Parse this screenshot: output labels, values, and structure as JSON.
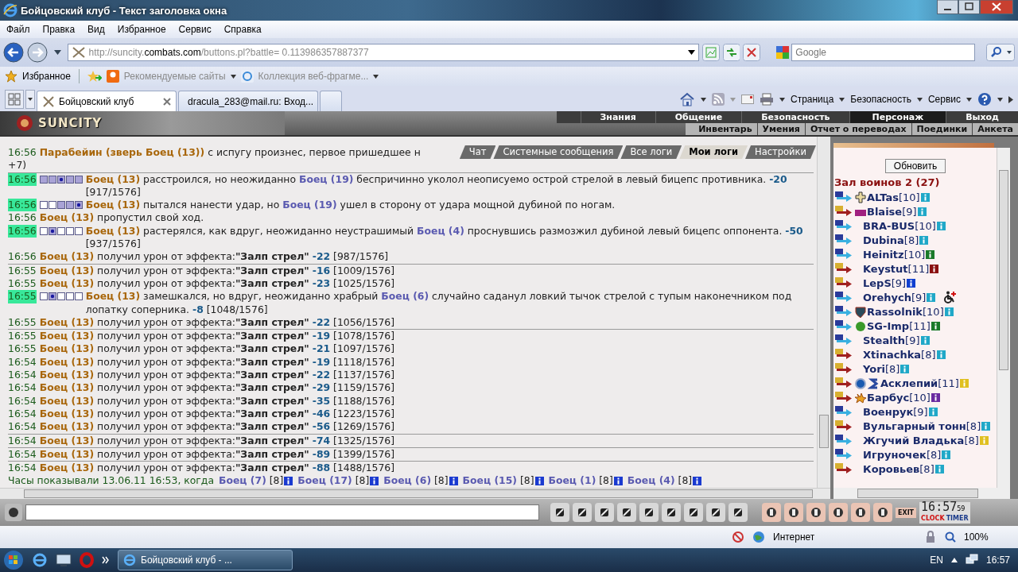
{
  "window": {
    "title": "Бойцовский клуб - Текст заголовка окна"
  },
  "menu": [
    "Файл",
    "Правка",
    "Вид",
    "Избранное",
    "Сервис",
    "Справка"
  ],
  "address": {
    "prefix": "http://suncity.",
    "domain": "combats.com",
    "path": "/buttons.pl?battle= 0.113986357887377"
  },
  "search": {
    "placeholder": "Google"
  },
  "favorites": {
    "label": "Избранное",
    "links": [
      "Рекомендуемые сайты",
      "Коллекция веб-фрагме..."
    ]
  },
  "tabs": [
    {
      "label": "Бойцовский клуб",
      "selected": true
    },
    {
      "label": "dracula_283@mail.ru: Вход...",
      "selected": false
    }
  ],
  "commands": [
    "Страница",
    "Безопасность",
    "Сервис"
  ],
  "game": {
    "logo": "SUNCITY",
    "nav": [
      {
        "label": "Знания",
        "selected": false
      },
      {
        "label": "Общение",
        "selected": false
      },
      {
        "label": "Безопасность",
        "selected": false
      },
      {
        "label": "Персонаж",
        "selected": true
      },
      {
        "label": "Выход",
        "selected": false
      }
    ],
    "subnav": [
      "Инвентарь",
      "Умения",
      "Отчет о переводах",
      "Поединки",
      "Анкета"
    ]
  },
  "log_tabs": [
    {
      "label": "Чат",
      "selected": false
    },
    {
      "label": "Системные сообщения",
      "selected": false
    },
    {
      "label": "Все логи",
      "selected": false
    },
    {
      "label": "Мои логи",
      "selected": true
    },
    {
      "label": "Настройки",
      "selected": false
    }
  ],
  "log": [
    {
      "kind": "action",
      "time": "16:56",
      "highlight": false,
      "divider": false,
      "parts": [
        {
          "kind": "actor",
          "text": "Парабейин (зверь Боец (13))"
        },
        {
          "kind": "text",
          "text": " с испугу произнес, первое пришедшее н"
        }
      ]
    },
    {
      "kind": "action",
      "divider": false,
      "parts": [
        {
          "kind": "text",
          "text": "+7)"
        }
      ]
    },
    {
      "kind": "action",
      "time": "16:56",
      "highlight": true,
      "divider": true,
      "zones": [
        {
          "kind": "filled"
        },
        {
          "kind": "filled"
        },
        {
          "kind": "dot"
        },
        {
          "kind": "filled"
        },
        {
          "kind": "filled"
        }
      ],
      "parts": [
        {
          "kind": "actor",
          "text": "Боец (13)"
        },
        {
          "kind": "text",
          "text": " расстроился, но неожиданно "
        },
        {
          "kind": "target",
          "text": "Боец (19)"
        },
        {
          "kind": "text",
          "text": " беспричинно уколол неописуемо острой стрелой в левый бицепс противника. "
        },
        {
          "kind": "damage",
          "text": "-20"
        },
        {
          "kind": "text",
          "text": " [917/1576]"
        }
      ]
    },
    {
      "kind": "action",
      "time": "16:56",
      "highlight": true,
      "divider": false,
      "zones": [
        {
          "kind": "empty"
        },
        {
          "kind": "empty"
        },
        {
          "kind": "filled"
        },
        {
          "kind": "filled"
        },
        {
          "kind": "dot"
        }
      ],
      "parts": [
        {
          "kind": "actor",
          "text": "Боец (13)"
        },
        {
          "kind": "text",
          "text": " пытался нанести удар, но "
        },
        {
          "kind": "target",
          "text": "Боец (19)"
        },
        {
          "kind": "text",
          "text": " ушел в сторону от удара мощной дубиной по ногам."
        }
      ]
    },
    {
      "kind": "action",
      "time": "16:56",
      "highlight": false,
      "divider": false,
      "parts": [
        {
          "kind": "actor",
          "text": "Боец (13)"
        },
        {
          "kind": "text",
          "text": " пропустил свой ход."
        }
      ]
    },
    {
      "kind": "action",
      "time": "16:56",
      "highlight": true,
      "divider": false,
      "zones": [
        {
          "kind": "empty"
        },
        {
          "kind": "dot"
        },
        {
          "kind": "empty"
        },
        {
          "kind": "empty"
        },
        {
          "kind": "empty"
        }
      ],
      "parts": [
        {
          "kind": "actor",
          "text": "Боец (13)"
        },
        {
          "kind": "text",
          "text": " растерялся, как вдруг, неожиданно неустрашимый "
        },
        {
          "kind": "target",
          "text": "Боец (4)"
        },
        {
          "kind": "text",
          "text": " проснувшись размозжил дубиной левый бицепс оппонента. "
        },
        {
          "kind": "damage",
          "text": "-50"
        },
        {
          "kind": "text",
          "text": " [937/1576]"
        }
      ]
    },
    {
      "kind": "effect",
      "time": "16:56",
      "highlight": false,
      "divider": false,
      "actor": "Боец (13)",
      "text": " получил урон от эффекта:",
      "effect": "\"Залп стрел\"",
      "damage": "-22",
      "hp": "[987/1576]"
    },
    {
      "kind": "effect",
      "time": "16:55",
      "highlight": false,
      "divider": true,
      "actor": "Боец (13)",
      "text": " получил урон от эффекта:",
      "effect": "\"Залп стрел\"",
      "damage": "-16",
      "hp": "[1009/1576]"
    },
    {
      "kind": "effect",
      "time": "16:55",
      "highlight": false,
      "divider": false,
      "actor": "Боец (13)",
      "text": " получил урон от эффекта:",
      "effect": "\"Залп стрел\"",
      "damage": "-23",
      "hp": "[1025/1576]"
    },
    {
      "kind": "action",
      "time": "16:55",
      "highlight": true,
      "divider": false,
      "zones": [
        {
          "kind": "empty"
        },
        {
          "kind": "dot"
        },
        {
          "kind": "empty"
        },
        {
          "kind": "empty"
        },
        {
          "kind": "empty"
        }
      ],
      "parts": [
        {
          "kind": "actor",
          "text": "Боец (13)"
        },
        {
          "kind": "text",
          "text": " замешкался, но вдруг, неожиданно храбрый "
        },
        {
          "kind": "target",
          "text": "Боец (6)"
        },
        {
          "kind": "text",
          "text": " случайно саданул ловкий тычок стрелой с тупым наконечником под лопатку соперника. "
        },
        {
          "kind": "damage",
          "text": "-8"
        },
        {
          "kind": "text",
          "text": " [1048/1576]"
        }
      ]
    },
    {
      "kind": "effect",
      "time": "16:55",
      "highlight": false,
      "divider": false,
      "actor": "Боец (13)",
      "text": " получил урон от эффекта:",
      "effect": "\"Залп стрел\"",
      "damage": "-22",
      "hp": "[1056/1576]"
    },
    {
      "kind": "effect",
      "time": "16:55",
      "highlight": false,
      "divider": true,
      "actor": "Боец (13)",
      "text": " получил урон от эффекта:",
      "effect": "\"Залп стрел\"",
      "damage": "-19",
      "hp": "[1078/1576]"
    },
    {
      "kind": "effect",
      "time": "16:55",
      "highlight": false,
      "divider": false,
      "actor": "Боец (13)",
      "text": " получил урон от эффекта:",
      "effect": "\"Залп стрел\"",
      "damage": "-21",
      "hp": "[1097/1576]"
    },
    {
      "kind": "effect",
      "time": "16:54",
      "highlight": false,
      "divider": false,
      "actor": "Боец (13)",
      "text": " получил урон от эффекта:",
      "effect": "\"Залп стрел\"",
      "damage": "-19",
      "hp": "[1118/1576]"
    },
    {
      "kind": "effect",
      "time": "16:54",
      "highlight": false,
      "divider": false,
      "actor": "Боец (13)",
      "text": " получил урон от эффекта:",
      "effect": "\"Залп стрел\"",
      "damage": "-22",
      "hp": "[1137/1576]"
    },
    {
      "kind": "effect",
      "time": "16:54",
      "highlight": false,
      "divider": false,
      "actor": "Боец (13)",
      "text": " получил урон от эффекта:",
      "effect": "\"Залп стрел\"",
      "damage": "-29",
      "hp": "[1159/1576]"
    },
    {
      "kind": "effect",
      "time": "16:54",
      "highlight": false,
      "divider": false,
      "actor": "Боец (13)",
      "text": " получил урон от эффекта:",
      "effect": "\"Залп стрел\"",
      "damage": "-35",
      "hp": "[1188/1576]"
    },
    {
      "kind": "effect",
      "time": "16:54",
      "highlight": false,
      "divider": false,
      "actor": "Боец (13)",
      "text": " получил урон от эффекта:",
      "effect": "\"Залп стрел\"",
      "damage": "-46",
      "hp": "[1223/1576]"
    },
    {
      "kind": "effect",
      "time": "16:54",
      "highlight": false,
      "divider": false,
      "actor": "Боец (13)",
      "text": " получил урон от эффекта:",
      "effect": "\"Залп стрел\"",
      "damage": "-56",
      "hp": "[1269/1576]"
    },
    {
      "kind": "effect",
      "time": "16:54",
      "highlight": false,
      "divider": true,
      "actor": "Боец (13)",
      "text": " получил урон от эффекта:",
      "effect": "\"Залп стрел\"",
      "damage": "-74",
      "hp": "[1325/1576]"
    },
    {
      "kind": "effect",
      "time": "16:54",
      "highlight": false,
      "divider": true,
      "actor": "Боец (13)",
      "text": " получил урон от эффекта:",
      "effect": "\"Залп стрел\"",
      "damage": "-89",
      "hp": "[1399/1576]"
    },
    {
      "kind": "effect",
      "time": "16:54",
      "highlight": false,
      "divider": true,
      "actor": "Боец (13)",
      "text": " получил урон от эффекта:",
      "effect": "\"Залп стрел\"",
      "damage": "-88",
      "hp": "[1488/1576]"
    },
    {
      "kind": "summary",
      "divider": false,
      "text": "Часы показывали 13.06.11 16:53, когда",
      "fighters": [
        {
          "name": "Боец (7)",
          "level": "[8]"
        },
        {
          "name": "Боец (17)",
          "level": "[8]"
        },
        {
          "name": "Боец (6)",
          "level": "[8]"
        },
        {
          "name": "Боец (15)",
          "level": "[8]"
        },
        {
          "name": "Боец (1)",
          "level": "[8]"
        },
        {
          "name": "Боец (4)",
          "level": "[8]"
        }
      ]
    }
  ],
  "room": {
    "refresh": "Обновить",
    "title": "Зал воинов 2 (27)",
    "users": [
      {
        "name": "ALTas",
        "level": "[10]",
        "kind": "blue",
        "badges": [
          {
            "kind": "cross"
          }
        ],
        "color": "#20a8c8"
      },
      {
        "name": "Blaise",
        "level": "[9]",
        "kind": "red",
        "badges": [
          {
            "kind": "nrg"
          }
        ],
        "color": "#20a8c8"
      },
      {
        "name": "BRA-BUS",
        "level": "[10]",
        "kind": "blue",
        "color": "#20a8c8"
      },
      {
        "name": "Dubina",
        "level": "[8]",
        "kind": "blue",
        "color": "#20a8c8"
      },
      {
        "name": "Heinitz",
        "level": "[10]",
        "kind": "blue",
        "color": "#1a7a2a"
      },
      {
        "name": "Keystut",
        "level": "[11]",
        "kind": "red",
        "color": "#8a1010"
      },
      {
        "name": "LepS",
        "level": "[9]",
        "kind": "red",
        "color": "#1040d0"
      },
      {
        "name": "Orehych",
        "level": "[9]",
        "kind": "blue",
        "color": "#20a8c8",
        "injured": true
      },
      {
        "name": "Rassolnik",
        "level": "[10]",
        "kind": "blue",
        "badges": [
          {
            "kind": "shield"
          }
        ],
        "color": "#20a8c8"
      },
      {
        "name": "SG-Imp",
        "level": "[11]",
        "kind": "blue",
        "badges": [
          {
            "kind": "orb"
          }
        ],
        "color": "#1a7a2a"
      },
      {
        "name": "Stealth",
        "level": "[9]",
        "kind": "blue",
        "color": "#20a8c8"
      },
      {
        "name": "Xtinachka",
        "level": "[8]",
        "kind": "red",
        "color": "#20a8c8"
      },
      {
        "name": "Yori",
        "level": "[8]",
        "kind": "red",
        "color": "#20a8c8"
      },
      {
        "name": "Асклепий",
        "level": "[11]",
        "kind": "red",
        "badges": [
          {
            "kind": "target"
          },
          {
            "kind": "rune"
          }
        ],
        "color": "#e0c020"
      },
      {
        "name": "Барбус",
        "level": "[10]",
        "kind": "red",
        "badges": [
          {
            "kind": "stars"
          }
        ],
        "color": "#6a2aa0"
      },
      {
        "name": "Военрук",
        "level": "[9]",
        "kind": "blue",
        "color": "#20a8c8"
      },
      {
        "name": "Вульгарный тонн",
        "level": "[8]",
        "kind": "red",
        "color": "#20a8c8"
      },
      {
        "name": "Жгучий Владька",
        "level": "[8]",
        "kind": "blue",
        "color": "#e0c020"
      },
      {
        "name": "Игруночек",
        "level": "[8]",
        "kind": "blue",
        "color": "#20a8c8"
      },
      {
        "name": "Коровьев",
        "level": "[8]",
        "kind": "red",
        "color": "#20a8c8"
      }
    ]
  },
  "toolbar": {
    "exit_label": "EXIT"
  },
  "clock": {
    "time": "16:57",
    "seconds": "59",
    "labels": [
      "CLOCK",
      "TIMER"
    ]
  },
  "status_bar": {
    "zone": "Интернет",
    "zoom": "100%"
  },
  "taskbar": {
    "task": "Бойцовский клуб - ...",
    "lang": "EN",
    "time": "16:57"
  }
}
